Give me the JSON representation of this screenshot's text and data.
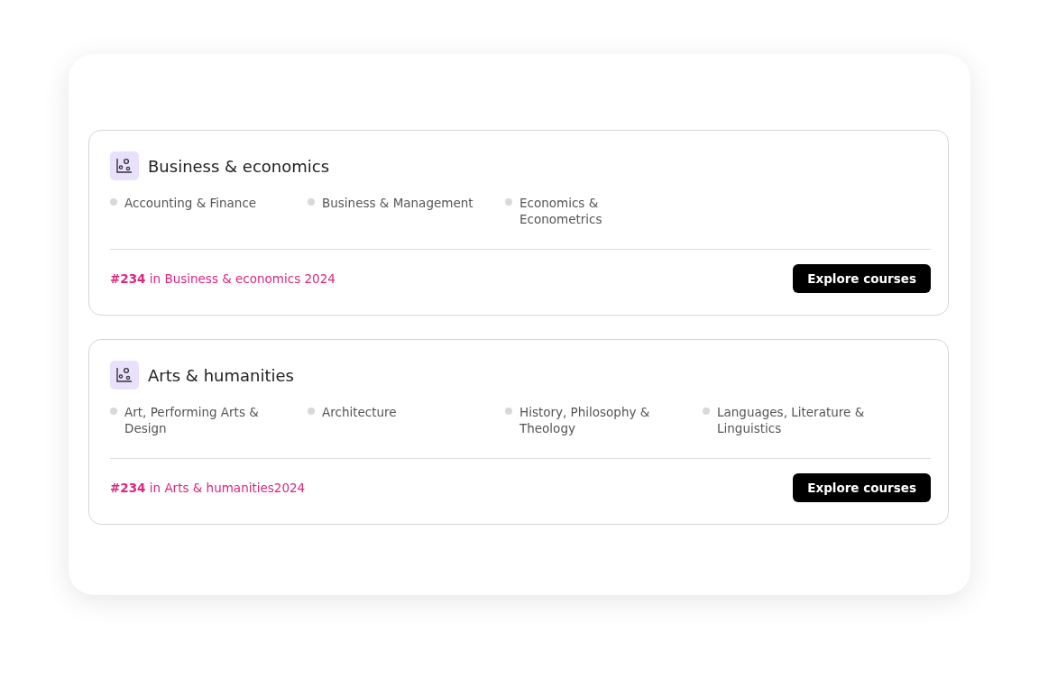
{
  "categories": [
    {
      "title": "Business & economics",
      "subjects": [
        "Accounting & Finance",
        "Business & Management",
        "Economics & Econometrics"
      ],
      "rank": "**#234** in Business & economics 2024",
      "button": "Explore courses"
    },
    {
      "title": "Arts & humanities",
      "subjects": [
        "Art, Performing Arts & Design",
        "Architecture",
        "History, Philosophy & Theology",
        "Languages, Literature & Linguistics"
      ],
      "rank": "**#234** in Arts & humanities2024",
      "button": "Explore courses"
    }
  ]
}
